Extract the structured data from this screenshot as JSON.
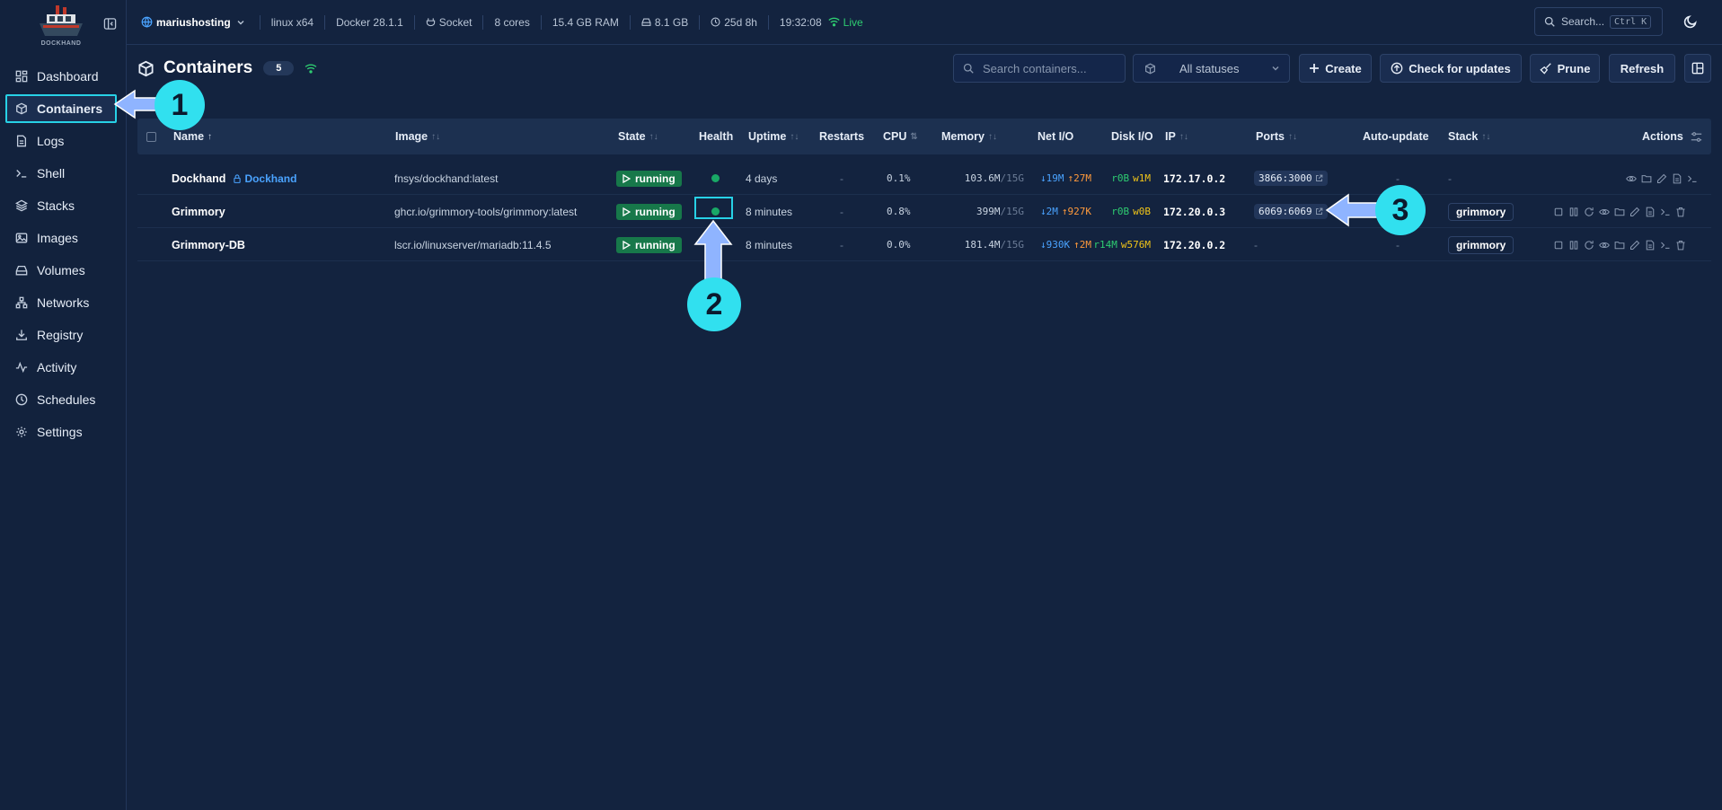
{
  "app": {
    "logo_text": "DOCKHAND"
  },
  "sidebar": {
    "items": [
      {
        "label": "Dashboard",
        "icon": "dashboard-icon"
      },
      {
        "label": "Containers",
        "icon": "box-icon",
        "active": true
      },
      {
        "label": "Logs",
        "icon": "logs-icon"
      },
      {
        "label": "Shell",
        "icon": "terminal-icon"
      },
      {
        "label": "Stacks",
        "icon": "layers-icon"
      },
      {
        "label": "Images",
        "icon": "images-icon"
      },
      {
        "label": "Volumes",
        "icon": "hard-drive-icon"
      },
      {
        "label": "Networks",
        "icon": "network-icon"
      },
      {
        "label": "Registry",
        "icon": "download-icon"
      },
      {
        "label": "Activity",
        "icon": "activity-icon"
      },
      {
        "label": "Schedules",
        "icon": "clock-icon"
      },
      {
        "label": "Settings",
        "icon": "gear-icon"
      }
    ]
  },
  "topbar": {
    "host": "mariushosting",
    "os": "linux x64",
    "docker": "Docker 28.1.1",
    "socket": "Socket",
    "cores": "8 cores",
    "ram": "15.4 GB RAM",
    "disk": "8.1 GB",
    "uptime": "25d 8h",
    "time": "19:32:08",
    "live": "Live",
    "search_label": "Search...",
    "shortcut": "Ctrl K"
  },
  "page": {
    "title": "Containers",
    "count": "5",
    "search_placeholder": "Search containers...",
    "status_filter": "All statuses",
    "create_label": "Create",
    "check_updates_label": "Check for updates",
    "prune_label": "Prune",
    "refresh_label": "Refresh"
  },
  "table": {
    "columns": [
      "Name",
      "Image",
      "State",
      "Health",
      "Uptime",
      "Restarts",
      "CPU",
      "Memory",
      "Net I/O",
      "Disk I/O",
      "IP",
      "Ports",
      "Auto-update",
      "Stack",
      "Actions"
    ],
    "rows": [
      {
        "name": "Dockhand",
        "tag": "Dockhand",
        "image": "fnsys/dockhand:latest",
        "state": "running",
        "uptime": "4 days",
        "restarts": "-",
        "cpu": "0.1%",
        "mem_used": "103.6M",
        "mem_total": "/15G",
        "net_down": "↓19M",
        "net_up": "↑27M",
        "disk_r": "r0B",
        "disk_w": "w1M",
        "ip": "172.17.0.2",
        "ports": "3866:3000",
        "autoupdate": "-",
        "stack": "-"
      },
      {
        "name": "Grimmory",
        "tag": "",
        "image": "ghcr.io/grimmory-tools/grimmory:latest",
        "state": "running",
        "uptime": "8 minutes",
        "restarts": "-",
        "cpu": "0.8%",
        "mem_used": "399M",
        "mem_total": "/15G",
        "net_down": "↓2M",
        "net_up": "↑927K",
        "disk_r": "r0B",
        "disk_w": "w0B",
        "ip": "172.20.0.3",
        "ports": "6069:6069",
        "autoupdate": "-",
        "stack": "grimmory"
      },
      {
        "name": "Grimmory-DB",
        "tag": "",
        "image": "lscr.io/linuxserver/mariadb:11.4.5",
        "state": "running",
        "uptime": "8 minutes",
        "restarts": "-",
        "cpu": "0.0%",
        "mem_used": "181.4M",
        "mem_total": "/15G",
        "net_down": "↓930K",
        "net_up": "↑2M",
        "disk_r": "r14M",
        "disk_w": "w576M",
        "ip": "172.20.0.2",
        "ports": "-",
        "autoupdate": "-",
        "stack": "grimmory"
      }
    ]
  },
  "annotations": {
    "one": "1",
    "two": "2",
    "three": "3"
  },
  "colors": {
    "accent": "#27d1e6",
    "running": "#17784a",
    "healthy": "#19a866",
    "live": "#2ecc71"
  }
}
